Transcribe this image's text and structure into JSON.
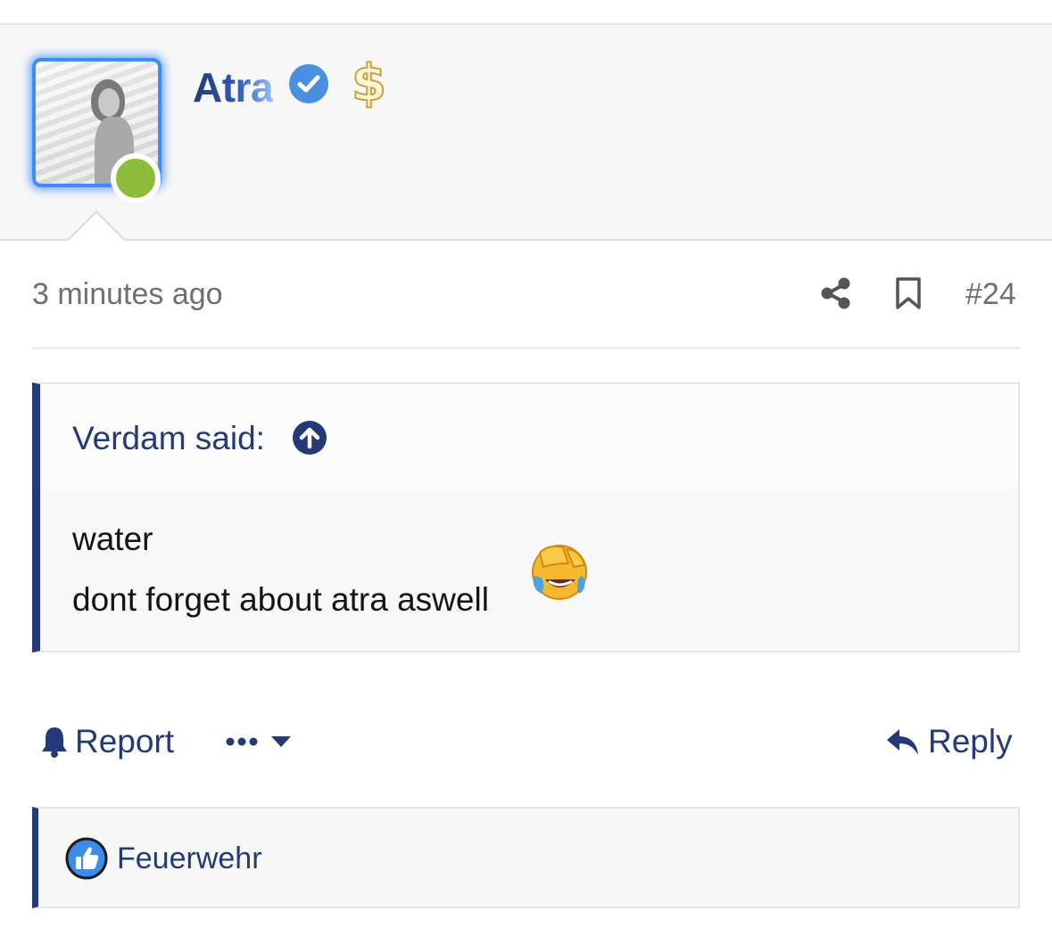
{
  "post": {
    "author": "Atra",
    "badges": {
      "verified": "verified-check-icon",
      "dollar": "$"
    },
    "avatar_status": "online",
    "timestamp": "3 minutes ago",
    "post_number": "#24"
  },
  "quote": {
    "author_said": "Verdam said:",
    "lines": [
      "water",
      "dont forget about atra aswell"
    ],
    "emoji": "face-with-tears-of-joy-emoji"
  },
  "actions": {
    "report_label": "Report",
    "more_icon": "ellipsis-icon",
    "reply_label": "Reply"
  },
  "reactions": {
    "type": "like",
    "users": "Feuerwehr"
  },
  "colors": {
    "brand_navy": "#243a78",
    "avatar_glow": "#3d8bff",
    "online": "#8dbb3a",
    "verified": "#4a90e2",
    "meta_text": "#6f6f6f"
  }
}
